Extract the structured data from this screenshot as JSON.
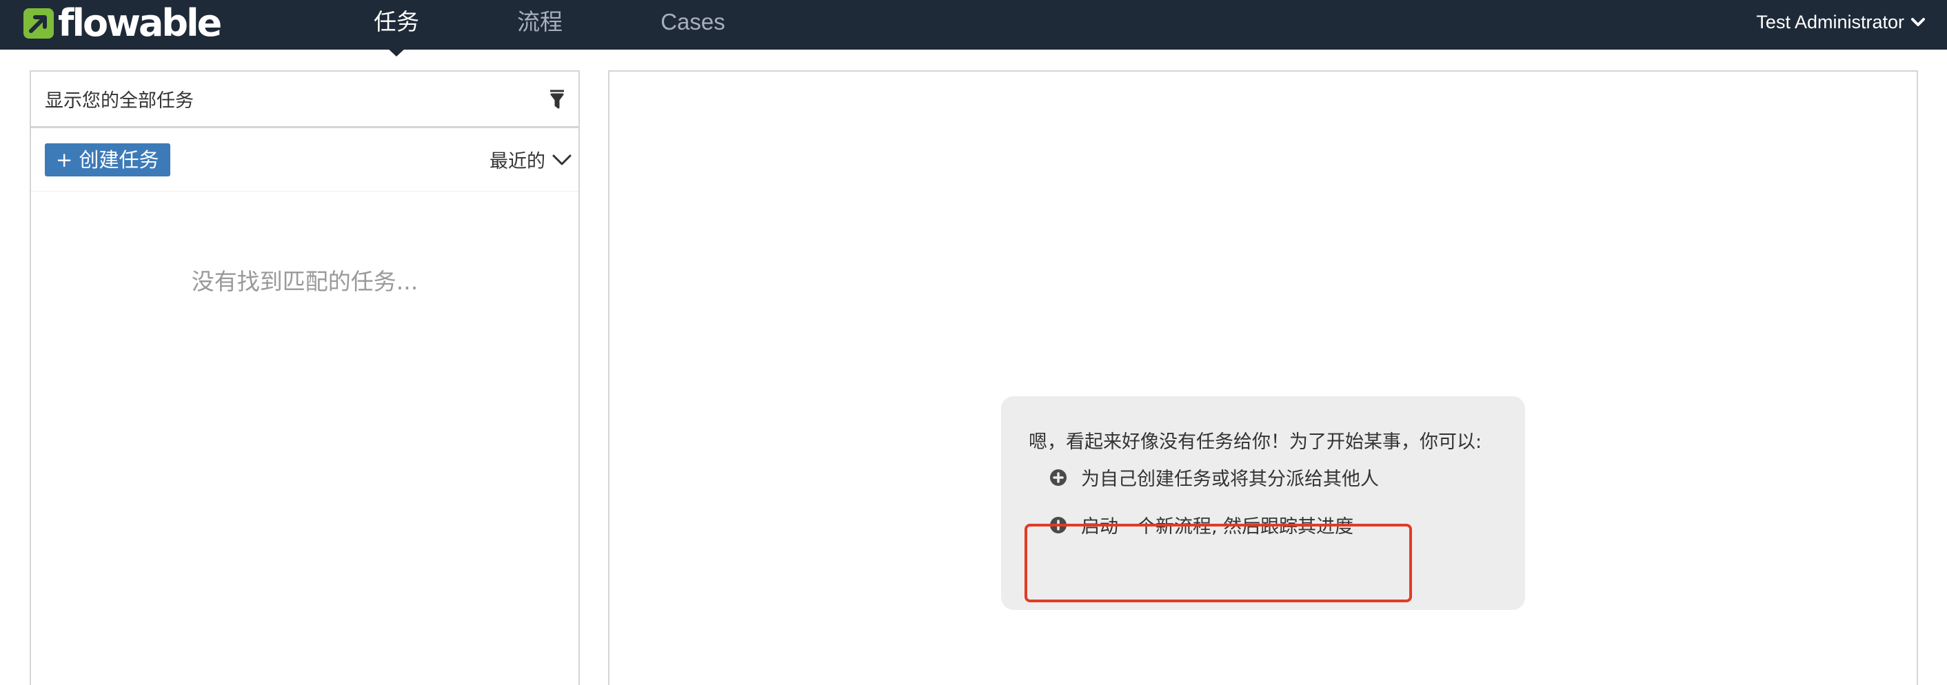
{
  "app": {
    "brand": "flowable",
    "user_menu_label": "Test Administrator"
  },
  "nav": {
    "tabs": [
      {
        "label": "任务",
        "active": true
      },
      {
        "label": "流程",
        "active": false
      },
      {
        "label": "Cases",
        "active": false
      }
    ]
  },
  "task_list": {
    "filter_label": "显示您的全部任务",
    "create_button_label": "+ 创建任务",
    "sort_label": "最近的",
    "empty_message": "没有找到匹配的任务..."
  },
  "help": {
    "intro": "嗯，看起来好像没有任务给你！为了开始某事，你可以:",
    "actions": [
      {
        "label": "为自己创建任务或将其分派给其他人"
      },
      {
        "label": "启动一个新流程, 然后跟踪其进度"
      }
    ]
  },
  "icons": {
    "brand_mark": "flowable-logo-icon",
    "user_caret": "chevron-down-icon",
    "filter": "filter-icon",
    "sort_caret": "chevron-down-icon",
    "action": "plus-circle-icon"
  },
  "colors": {
    "navbar": "#1f2a38",
    "brand_green": "#7ebd3a",
    "primary_button": "#3d7ab8",
    "highlight": "#e23b24",
    "help_box": "#ededed"
  }
}
